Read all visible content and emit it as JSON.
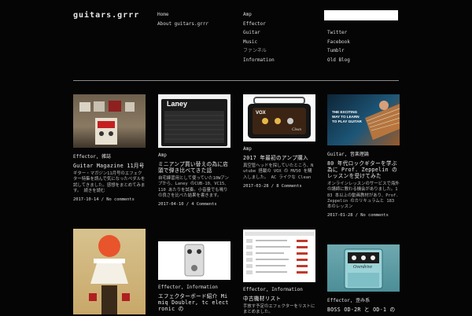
{
  "site": {
    "logo": "guitars.grrr"
  },
  "nav": {
    "col1": [
      "Home",
      "About guitars.grrr"
    ],
    "col2": [
      "Amp",
      "Effector",
      "Guitar",
      "Music",
      "ファンネル",
      "Information"
    ]
  },
  "search": {
    "placeholder": ""
  },
  "social": [
    "Twitter",
    "Facebook",
    "Tumblr",
    "Old Blog"
  ],
  "posts": [
    {
      "category": "Effector, 雑誌",
      "title": "Guitar Magazine 11月号",
      "excerpt": "ギター・マガジン11月号のエフェクター特集を読んで気になったペダルを試してきました。感想をまとめてみます。 続きを読む",
      "date": "2017-10-14",
      "comments": "No comments"
    },
    {
      "category": "Amp",
      "title": "ミニアンプ買い替えの為に店頭で弾き比べてきた話",
      "excerpt": "自宅練習用として使っていた10Wアンプから、Laney のCUB-10、VC15、110 あたりを試奏。小音量でも鳴りの良さを比べた結果を書きます。",
      "date": "2017-04-10",
      "comments": "4 Comments"
    },
    {
      "category": "Amp",
      "title": "2017 年最初のアンプ購入",
      "excerpt": "真空管ヘッドを探していたところ、Nutube 搭載の VOX の MV50 を購入しました。 AC ライクな Clean",
      "date": "2017-03-28",
      "comments": "8 Comments"
    },
    {
      "category": "Guitar, 音楽理論",
      "title": "80 年代ロックギターを学ぶ為に Prof. Zeppelin のレッスンを受けてみた",
      "excerpt": "オンラインレッスンのサービスで海外の講師に教わる機会がありました。183 本以上の動画教材があり、Prof. Zeppelin のカリキュラムと 183 本のレッスン",
      "date": "2017-01-28",
      "comments": "No comments"
    },
    {
      "category": "Effector, Information",
      "title": "エフェクターボード紹介 Mimiq Doubler, tc electronic の",
      "excerpt": "",
      "date": "",
      "comments": ""
    },
    {
      "category": "Effector, Information",
      "title": "中古機材リスト",
      "excerpt": "手放す予定のエフェクターをリストにまとめました。",
      "date": "",
      "comments": ""
    },
    {
      "category": "Effector, 歪み系",
      "title": "BOSS OD-2R と OD-1 の",
      "excerpt": "",
      "date": "",
      "comments": ""
    }
  ],
  "thumb_labels": {
    "laney": "Laney",
    "vox": "VOX",
    "vox_clean": "Clean",
    "poster_l1": "THE EXCITING",
    "poster_l2": "WAY TO LEARN",
    "poster_l3": "TO PLAY GUITAR",
    "boss": "Overdrive"
  }
}
